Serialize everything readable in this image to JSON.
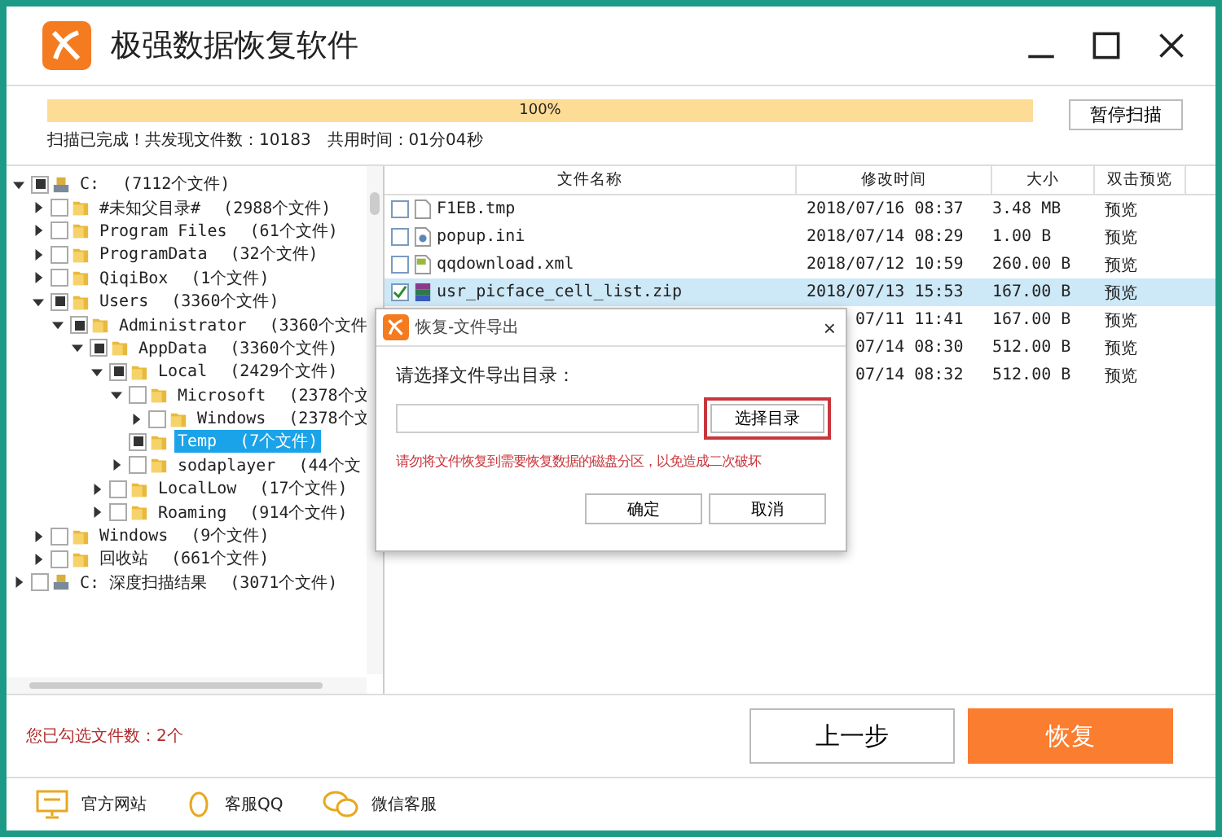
{
  "window": {
    "title": "极强数据恢复软件"
  },
  "progress": {
    "level": 1,
    "label": "100%",
    "pause_button": "暂停扫描",
    "status": "扫描已完成！共发现文件数：10183　共用时间：01分04秒"
  },
  "tree": [
    {
      "label": "C:",
      "count": "(7112个文件)",
      "kind": "drive",
      "checked": true,
      "expandable": true,
      "expanded": true,
      "selected": false,
      "children": [
        {
          "label": "#未知父目录#",
          "count": "(2988个文件)",
          "kind": "folder",
          "checked": false,
          "expandable": true,
          "expanded": false,
          "selected": false
        },
        {
          "label": "Program Files",
          "count": "(61个文件)",
          "kind": "folder",
          "checked": false,
          "expandable": true,
          "expanded": false,
          "selected": false
        },
        {
          "label": "ProgramData",
          "count": "(32个文件)",
          "kind": "folder",
          "checked": false,
          "expandable": true,
          "expanded": false,
          "selected": false
        },
        {
          "label": "QiqiBox",
          "count": "(1个文件)",
          "kind": "folder",
          "checked": false,
          "expandable": true,
          "expanded": false,
          "selected": false
        },
        {
          "label": "Users",
          "count": "(3360个文件)",
          "kind": "folder",
          "checked": true,
          "expandable": true,
          "expanded": true,
          "selected": false,
          "children": [
            {
              "label": "Administrator",
              "count": "(3360个文件",
              "kind": "folder",
              "checked": true,
              "expandable": true,
              "expanded": true,
              "selected": false,
              "children": [
                {
                  "label": "AppData",
                  "count": "(3360个文件)",
                  "kind": "folder",
                  "checked": true,
                  "expandable": true,
                  "expanded": true,
                  "selected": false,
                  "children": [
                    {
                      "label": "Local",
                      "count": "(2429个文件)",
                      "kind": "folder",
                      "checked": true,
                      "expandable": true,
                      "expanded": true,
                      "selected": false,
                      "children": [
                        {
                          "label": "Microsoft",
                          "count": "(2378个文",
                          "kind": "folder",
                          "checked": false,
                          "expandable": true,
                          "expanded": true,
                          "selected": false,
                          "children": [
                            {
                              "label": "Windows",
                              "count": "(2378个文",
                              "kind": "folder",
                              "checked": false,
                              "expandable": true,
                              "expanded": false,
                              "selected": false
                            }
                          ]
                        },
                        {
                          "label": "Temp",
                          "count": "(7个文件)",
                          "kind": "folder",
                          "checked": true,
                          "expandable": false,
                          "selected": true
                        },
                        {
                          "label": "sodaplayer",
                          "count": "(44个文",
                          "kind": "folder",
                          "checked": false,
                          "expandable": true,
                          "expanded": false,
                          "selected": false
                        }
                      ]
                    },
                    {
                      "label": "LocalLow",
                      "count": "(17个文件)",
                      "kind": "folder",
                      "checked": false,
                      "expandable": true,
                      "expanded": false,
                      "selected": false
                    },
                    {
                      "label": "Roaming",
                      "count": "(914个文件)",
                      "kind": "folder",
                      "checked": false,
                      "expandable": true,
                      "expanded": false,
                      "selected": false
                    }
                  ]
                }
              ]
            }
          ]
        },
        {
          "label": "Windows",
          "count": "(9个文件)",
          "kind": "folder",
          "checked": false,
          "expandable": true,
          "expanded": false,
          "selected": false
        },
        {
          "label": "回收站",
          "count": "(661个文件)",
          "kind": "folder",
          "checked": false,
          "expandable": true,
          "expanded": false,
          "selected": false
        }
      ]
    },
    {
      "label": "C: 深度扫描结果",
      "count": "(3071个文件)",
      "kind": "drive",
      "checked": false,
      "expandable": true,
      "expanded": false,
      "selected": false
    }
  ],
  "table": {
    "columns": [
      "文件名称",
      "修改时间",
      "大小",
      "双击预览"
    ],
    "rows": [
      {
        "name": "F1EB.tmp",
        "kind": "blank",
        "time": "2018/07/16 08:37",
        "size": "3.48 MB",
        "preview": "预览",
        "checked": false,
        "selected": false
      },
      {
        "name": "popup.ini",
        "kind": "settings",
        "time": "2018/07/14 08:29",
        "size": "1.00 B",
        "preview": "预览",
        "checked": false,
        "selected": false
      },
      {
        "name": "qqdownload.xml",
        "kind": "xml",
        "time": "2018/07/12 10:59",
        "size": "260.00 B",
        "preview": "预览",
        "checked": false,
        "selected": false
      },
      {
        "name": "usr_picface_cell_list.zip",
        "kind": "zip",
        "time": "2018/07/13 15:53",
        "size": "167.00 B",
        "preview": "预览",
        "checked": true,
        "selected": true
      },
      {
        "time": "07/11 11:41",
        "size": "167.00 B",
        "preview": "预览"
      },
      {
        "time": "07/14 08:30",
        "size": "512.00 B",
        "preview": "预览"
      },
      {
        "time": "07/14 08:32",
        "size": "512.00 B",
        "preview": "预览"
      }
    ]
  },
  "selected_count": "您已勾选文件数：2个",
  "buttons": {
    "back": "上一步",
    "recover": "恢复"
  },
  "footer": [
    "官方网站",
    "客服QQ",
    "微信客服"
  ],
  "dialog": {
    "title": "恢复-文件导出",
    "close": "×",
    "prompt": "请选择文件导出目录：",
    "browse": "选择目录",
    "warning": "请勿将文件恢复到需要恢复数据的磁盘分区，以免造成二次破坏",
    "ok": "确定",
    "cancel": "取消"
  }
}
